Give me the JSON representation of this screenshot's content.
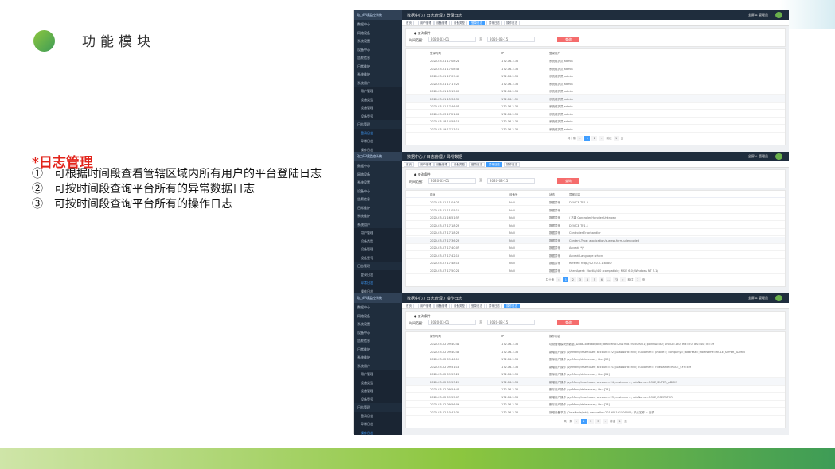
{
  "slide": {
    "title": "功能模块",
    "heading": "*日志管理",
    "bullets": [
      "①　可根据时间段查看管辖区域内所有用户的平台登陆日志",
      "②　可按时间段查询平台所有的异常数据日志",
      "③　可按时间段查询平台所有的操作日志"
    ],
    "colors": {
      "accent_red": "#e2231a",
      "green": "#3e9c56",
      "light_green": "#8cc63f"
    }
  },
  "app": {
    "logo_text": "动力环境监控系统",
    "user_label": "全屏 ⌂ 管理员",
    "sidebar_items": [
      "数据中心",
      "网络设备",
      "系统设置",
      "设备中心",
      "告警信息",
      "日常维护",
      "系统维护",
      "系统用户",
      "用户管理",
      "设备类型",
      "设备管理",
      "设备型号",
      "日志管理",
      "登录日志",
      "异常日志",
      "操作日志"
    ],
    "tabs": [
      "首页",
      "用户管理",
      "设备管理",
      "设备类型",
      "登录日志",
      "异常日志",
      "操作日志"
    ],
    "filter": {
      "head": "● 查询条件",
      "label": "时间范围：",
      "start": "2020-03-01",
      "sep": "至",
      "end": "2020-03-15",
      "button": "查询"
    },
    "pager": {
      "total": "共十条",
      "goto": "前往",
      "page": "1",
      "unit": "页"
    }
  },
  "panels": [
    {
      "crumb": "数据中心 / 日志管理 / 登录日志",
      "active_tab": 4,
      "columns": [
        "登录时间",
        "IP",
        "登录用户"
      ],
      "rows": [
        [
          "2020-03-01 17:08:24",
          "172.16.3.36",
          "系统维护员 admin"
        ],
        [
          "2020-03-01 17:08:48",
          "172.16.3.36",
          "系统维护员 admin"
        ],
        [
          "2020-03-01 17:09:42",
          "172.16.3.36",
          "系统维护员 admin"
        ],
        [
          "2020-03-01 17:17:20",
          "172.16.3.36",
          "系统维护员 admin"
        ],
        [
          "2020-03-01 13:15:03",
          "172.16.3.36",
          "系统维护员 admin"
        ],
        [
          "2020-03-01 15:36:30",
          "172.16.1.39",
          "系统维护员 admin"
        ],
        [
          "2020-03-01 17:46:07",
          "172.16.3.36",
          "系统维护员 admin"
        ],
        [
          "2020-03-03 17:21:06",
          "172.16.3.36",
          "系统维护员 admin"
        ],
        [
          "2020-03-18 14:58:16",
          "172.16.3.36",
          "系统维护员 admin"
        ],
        [
          "2020-03-19 17:13:15",
          "172.16.3.36",
          "系统维护员 admin"
        ]
      ],
      "pages": [
        "1",
        "2"
      ]
    },
    {
      "crumb": "数据中心 / 日志管理 / 异常数据",
      "active_tab": 5,
      "columns": [
        "时间",
        "设备号",
        "状态",
        "异常内容"
      ],
      "rows": [
        [
          "2020-03-01 11:04:27",
          "Null",
          "数据异常",
          "DEVICE TP1.0"
        ],
        [
          "2020-03-01 11:05:11",
          "Null",
          "数据异常",
          ""
        ],
        [
          "2020-03-01 16:51:57",
          "Null",
          "数据异常",
          "/ 不能    Controller.Handler.Unknown"
        ],
        [
          "2020-03-07 17:18:23",
          "Null",
          "数据异常",
          "DEVICE TP1.1"
        ],
        [
          "2020-03-07 17:18:23",
          "Null",
          "数据异常",
          "Controller.Errorhandler"
        ],
        [
          "2020-03-07 17:36:23",
          "Null",
          "数据异常",
          "Content-Type: application/x-www-form-urlencoded"
        ],
        [
          "2020-03-07 17:40:07",
          "Null",
          "数据异常",
          "Accept: */*"
        ],
        [
          "2020-03-07 17:42:15",
          "Null",
          "数据异常",
          "Accept-Language: zh-cn"
        ],
        [
          "2020-03-07 17:48:16",
          "Null",
          "数据异常",
          "Referer: http://127.0.0.1:8080/"
        ],
        [
          "2020-03-07 17:50:24",
          "Null",
          "数据异常",
          "User-Agent: Mozilla/4.0 (compatible; MSIE 6.0; Windows NT 5.1)"
        ]
      ],
      "pages": [
        "1",
        "2",
        "3",
        "4",
        "5",
        "6",
        "...",
        "73"
      ]
    },
    {
      "crumb": "数据中心 / 日志管理 / 操作日志",
      "active_tab": 6,
      "columns": [
        "操作时间",
        "IP",
        "操作内容"
      ],
      "rows": [
        [
          "2020-03-02 09:40:44",
          "172.16.3.36",
          "动物管理模块的数据 /DataCollector/add; deviceNo=201908191509001; pointID=80; uncID=180; eid=70; ais=40; id=39"
        ],
        [
          "2020-03-02 09:40:48",
          "172.16.3.36",
          "新增用户操作 /sysMenu/insertuser; account=22; password=null; customer=; phone=; company=; address=; roleName=ROLE_SUPER_ADMIN"
        ],
        [
          "2020-03-02 09:46:19",
          "172.16.3.36",
          "删除用户操作 /sysMenu/deleteuser; ids=[20]"
        ],
        [
          "2020-03-02 09:51:18",
          "172.16.3.36",
          "新增用户操作 /sysMenu/insertuser; account=21; password=null; customer=; roleName=ROLE_SYSTEM"
        ],
        [
          "2020-03-02 09:53:28",
          "172.16.3.36",
          "删除用户操作 /sysMenu/deleteuser; ids=[21]"
        ],
        [
          "2020-03-02 09:53:29",
          "172.16.3.36",
          "新增用户操作 /sysMenu/insertuser; account=24; customer=; roleName=ROLE_SUPER_ADMIN"
        ],
        [
          "2020-03-02 09:54:44",
          "172.16.3.36",
          "删除用户操作 /sysMenu/deleteuser; ids=[24]"
        ],
        [
          "2020-03-02 09:55:07",
          "172.16.3.36",
          "新增用户操作 /sysMenu/insertuser; account=23; customer=; roleName=ROLE_OPERATOR"
        ],
        [
          "2020-03-02 09:56:09",
          "172.16.3.36",
          "删除用户操作 /sysMenu/deleteuser; ids=[23]"
        ],
        [
          "2020-03-02 10:41:31",
          "172.16.3.36",
          "新增设备节点 /DataNode/add; deviceNo=201908191509001; 节点名称 = 空调"
        ]
      ],
      "pages": [
        "1",
        "2",
        "3"
      ]
    }
  ]
}
